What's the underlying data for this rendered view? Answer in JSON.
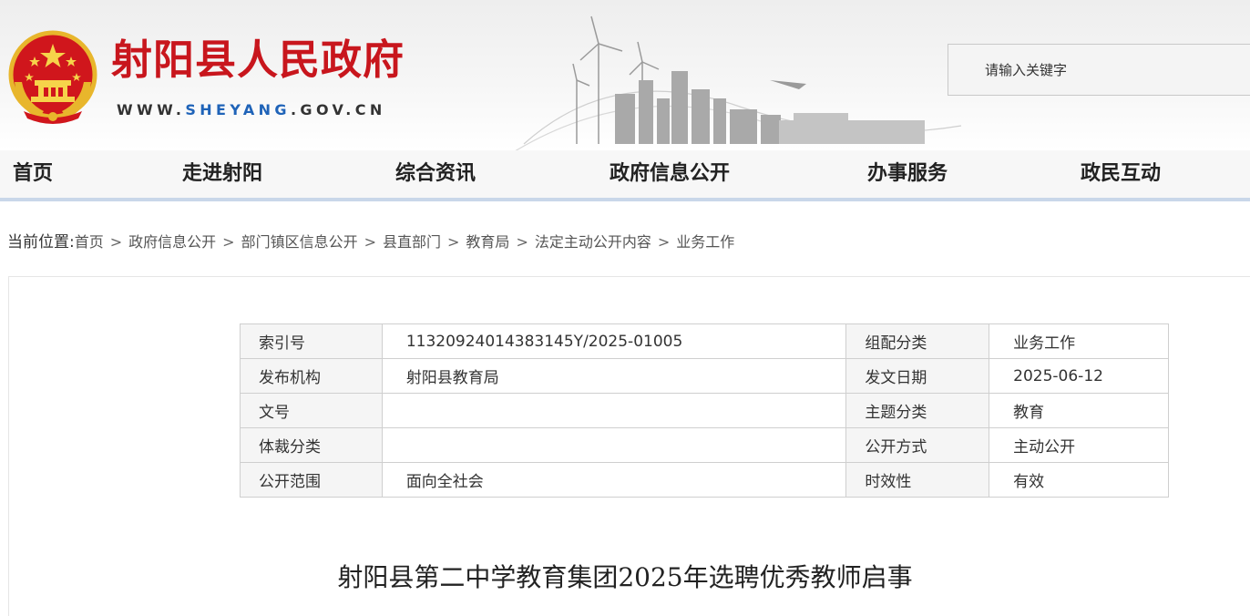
{
  "header": {
    "site_title": "射阳县人民政府",
    "url_prefix": "WWW.",
    "url_highlight": "SHEYANG",
    "url_suffix": ".GOV.CN",
    "emblem_icon": "national-emblem-icon",
    "skyline_icon": "city-skyline-illustration",
    "search": {
      "placeholder": "请输入关键字",
      "value": ""
    }
  },
  "nav": {
    "items": [
      {
        "label": "首页"
      },
      {
        "label": "走进射阳"
      },
      {
        "label": "综合资讯"
      },
      {
        "label": "政府信息公开"
      },
      {
        "label": "办事服务"
      },
      {
        "label": "政民互动"
      }
    ]
  },
  "breadcrumb": {
    "lead": "当前位置:",
    "items": [
      "首页",
      "政府信息公开",
      "部门镇区信息公开",
      "县直部门",
      "教育局",
      "法定主动公开内容",
      "业务工作"
    ],
    "separator": ">"
  },
  "meta": {
    "rows": [
      {
        "k1": "索引号",
        "v1": "11320924014383145Y/2025-01005",
        "k2": "组配分类",
        "v2": "业务工作"
      },
      {
        "k1": "发布机构",
        "v1": "射阳县教育局",
        "k2": "发文日期",
        "v2": "2025-06-12"
      },
      {
        "k1": "文号",
        "v1": "",
        "k2": "主题分类",
        "v2": "教育"
      },
      {
        "k1": "体裁分类",
        "v1": "",
        "k2": "公开方式",
        "v2": "主动公开"
      },
      {
        "k1": "公开范围",
        "v1": "面向全社会",
        "k2": "时效性",
        "v2": "有效"
      }
    ]
  },
  "article": {
    "title": "射阳县第二中学教育集团2025年选聘优秀教师启事"
  },
  "colors": {
    "brand_red": "#c8161d",
    "url_blue": "#1f63b8",
    "nav_border": "#c9d7e9"
  }
}
